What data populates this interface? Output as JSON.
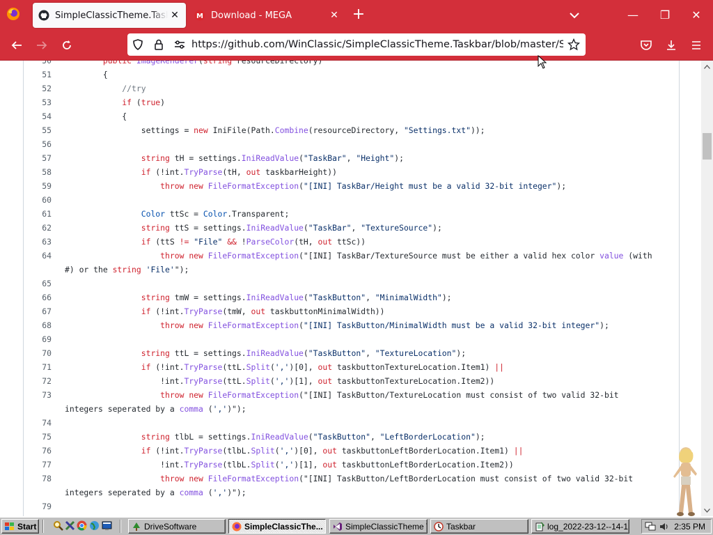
{
  "browser": {
    "tabs": [
      {
        "title": "SimpleClassicTheme.Taskbar/ImageRenderer.cs",
        "active": true
      },
      {
        "title": "Download - MEGA",
        "active": false
      }
    ],
    "url": "https://github.com/WinClassic/SimpleClassicTheme.Taskbar/blob/master/SimpleClassicTheme.Taskbar/ImageRenderer.cs"
  },
  "code": {
    "lines": [
      {
        "n": "50",
        "t": "        public ImageRenderer(string resourceDirectory)"
      },
      {
        "n": "51",
        "t": "        {"
      },
      {
        "n": "52",
        "t": "            //try"
      },
      {
        "n": "53",
        "t": "            if (true)"
      },
      {
        "n": "54",
        "t": "            {"
      },
      {
        "n": "55",
        "t": "                settings = new IniFile(Path.Combine(resourceDirectory, \"Settings.txt\"));"
      },
      {
        "n": "56",
        "t": ""
      },
      {
        "n": "57",
        "t": "                string tH = settings.IniReadValue(\"TaskBar\", \"Height\");"
      },
      {
        "n": "58",
        "t": "                if (!int.TryParse(tH, out taskbarHeight))"
      },
      {
        "n": "59",
        "t": "                    throw new FileFormatException(\"[INI] TaskBar/Height must be a valid 32-bit integer\");"
      },
      {
        "n": "60",
        "t": ""
      },
      {
        "n": "61",
        "t": "                Color ttSc = Color.Transparent;"
      },
      {
        "n": "62",
        "t": "                string ttS = settings.IniReadValue(\"TaskBar\", \"TextureSource\");"
      },
      {
        "n": "63",
        "t": "                if (ttS != \"File\" && !ParseColor(tH, out ttSc))"
      },
      {
        "n": "64",
        "t": "                    throw new FileFormatException(\"[INI] TaskBar/TextureSource must be either a valid hex color value (with"
      },
      {
        "n": "",
        "t": "#) or the string 'File'\");"
      },
      {
        "n": "65",
        "t": ""
      },
      {
        "n": "66",
        "t": "                string tmW = settings.IniReadValue(\"TaskButton\", \"MinimalWidth\");"
      },
      {
        "n": "67",
        "t": "                if (!int.TryParse(tmW, out taskbuttonMinimalWidth))"
      },
      {
        "n": "68",
        "t": "                    throw new FileFormatException(\"[INI] TaskButton/MinimalWidth must be a valid 32-bit integer\");"
      },
      {
        "n": "69",
        "t": ""
      },
      {
        "n": "70",
        "t": "                string ttL = settings.IniReadValue(\"TaskButton\", \"TextureLocation\");"
      },
      {
        "n": "71",
        "t": "                if (!int.TryParse(ttL.Split(',')[0], out taskbuttonTextureLocation.Item1) ||"
      },
      {
        "n": "72",
        "t": "                    !int.TryParse(ttL.Split(',')[1], out taskbuttonTextureLocation.Item2))"
      },
      {
        "n": "73",
        "t": "                    throw new FileFormatException(\"[INI] TaskButton/TextureLocation must consist of two valid 32-bit"
      },
      {
        "n": "",
        "t": "integers seperated by a comma (',')\");"
      },
      {
        "n": "74",
        "t": ""
      },
      {
        "n": "75",
        "t": "                string tlbL = settings.IniReadValue(\"TaskButton\", \"LeftBorderLocation\");"
      },
      {
        "n": "76",
        "t": "                if (!int.TryParse(tlbL.Split(',')[0], out taskbuttonLeftBorderLocation.Item1) ||"
      },
      {
        "n": "77",
        "t": "                    !int.TryParse(tlbL.Split(',')[1], out taskbuttonLeftBorderLocation.Item2))"
      },
      {
        "n": "78",
        "t": "                    throw new FileFormatException(\"[INI] TaskButton/LeftBorderLocation must consist of two valid 32-bit"
      },
      {
        "n": "",
        "t": "integers seperated by a comma (',')\");"
      },
      {
        "n": "79",
        "t": ""
      }
    ]
  },
  "taskbar": {
    "start_label": "Start",
    "buttons": [
      {
        "label": "DriveSoftware",
        "pressed": false,
        "icon": "tree-icon"
      },
      {
        "label": "SimpleClassicThe...",
        "pressed": true,
        "icon": "firefox-icon"
      },
      {
        "label": "SimpleClassicTheme T...",
        "pressed": false,
        "icon": "visual-studio-icon"
      },
      {
        "label": "Taskbar",
        "pressed": false,
        "icon": "taskbar-app-icon"
      },
      {
        "label": "log_2022-23-12--14-1...",
        "pressed": false,
        "icon": "notepad-icon"
      }
    ],
    "clock": "2:35 PM"
  },
  "colors": {
    "chrome": "#d32f3a",
    "keyword": "#cf222e",
    "function": "#8250df",
    "type": "#0550ae",
    "string": "#0a3069",
    "comment": "#6e7781"
  }
}
